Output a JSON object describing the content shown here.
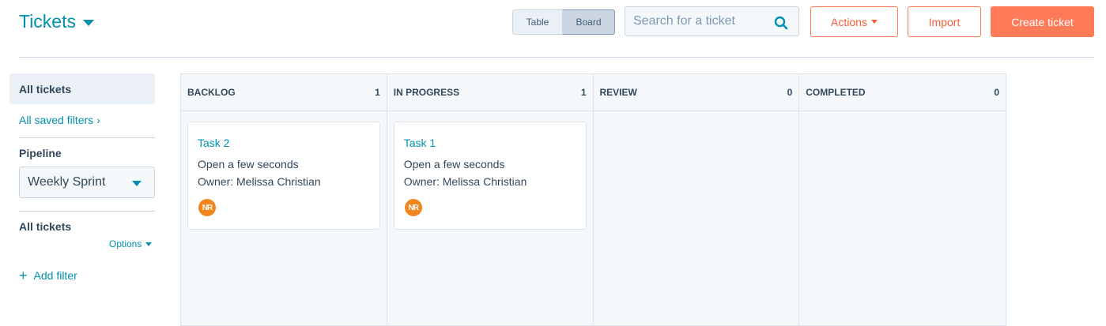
{
  "header": {
    "title": "Tickets",
    "view_toggle": {
      "table_label": "Table",
      "board_label": "Board",
      "active": "Board"
    },
    "search": {
      "placeholder": "Search for a ticket",
      "value": ""
    },
    "actions_label": "Actions",
    "import_label": "Import",
    "create_label": "Create ticket"
  },
  "sidebar": {
    "all_tickets_label": "All tickets",
    "saved_filters_label": "All saved filters",
    "pipeline_label": "Pipeline",
    "pipeline_value": "Weekly Sprint",
    "section_label": "All tickets",
    "options_label": "Options",
    "add_filter_label": "Add filter"
  },
  "board": {
    "columns": [
      {
        "title": "BACKLOG",
        "count": "1",
        "cards": [
          {
            "title": "Task 2",
            "status": "Open a few seconds",
            "owner": "Owner: Melissa Christian",
            "avatar_initials": "NR"
          }
        ]
      },
      {
        "title": "IN PROGRESS",
        "count": "1",
        "cards": [
          {
            "title": "Task 1",
            "status": "Open a few seconds",
            "owner": "Owner: Melissa Christian",
            "avatar_initials": "NR"
          }
        ]
      },
      {
        "title": "REVIEW",
        "count": "0",
        "cards": []
      },
      {
        "title": "COMPLETED",
        "count": "0",
        "cards": []
      }
    ]
  },
  "colors": {
    "accent": "#0091ae",
    "brand_orange": "#ff7a59",
    "text": "#33475b",
    "avatar": "#f2851d"
  }
}
